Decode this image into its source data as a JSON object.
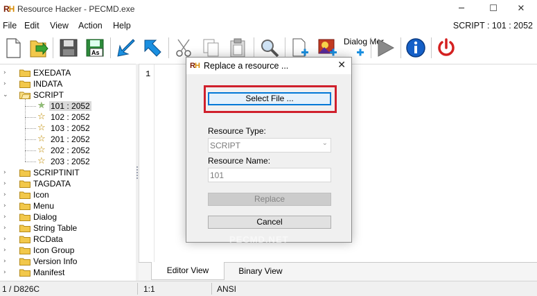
{
  "window": {
    "title": "Resource Hacker - PECMD.exe",
    "logo_text": "RH",
    "controls": [
      "─",
      "☐",
      "✕"
    ]
  },
  "menubar": {
    "items": [
      "File",
      "Edit",
      "View",
      "Action",
      "Help"
    ],
    "resource_id": "SCRIPT : 101 : 2052"
  },
  "toolbar": {
    "buttons": [
      "new-file-icon",
      "open-file-icon",
      "save-icon",
      "save-as-icon",
      "compile-icon",
      "run-script-icon",
      "cut-icon",
      "copy-icon",
      "paste-icon",
      "find-icon",
      "add-resource-icon",
      "replace-image-icon",
      "dialog-menu-icon",
      "play-icon",
      "info-icon",
      "power-icon"
    ],
    "dialog_menu_label": "Dialog Mer"
  },
  "tree": {
    "expanded_group": "SCRIPT",
    "items": [
      {
        "label": "EXEDATA",
        "kind": "folder"
      },
      {
        "label": "INDATA",
        "kind": "folder"
      },
      {
        "label": "SCRIPT",
        "kind": "folder-open"
      },
      {
        "label": "101 : 2052",
        "kind": "leaf",
        "selected": true
      },
      {
        "label": "102 : 2052",
        "kind": "leaf"
      },
      {
        "label": "103 : 2052",
        "kind": "leaf"
      },
      {
        "label": "201 : 2052",
        "kind": "leaf"
      },
      {
        "label": "202 : 2052",
        "kind": "leaf"
      },
      {
        "label": "203 : 2052",
        "kind": "leaf"
      },
      {
        "label": "SCRIPTINIT",
        "kind": "folder"
      },
      {
        "label": "TAGDATA",
        "kind": "folder"
      },
      {
        "label": "Icon",
        "kind": "folder"
      },
      {
        "label": "Menu",
        "kind": "folder"
      },
      {
        "label": "Dialog",
        "kind": "folder"
      },
      {
        "label": "String Table",
        "kind": "folder"
      },
      {
        "label": "RCData",
        "kind": "folder"
      },
      {
        "label": "Icon Group",
        "kind": "folder"
      },
      {
        "label": "Version Info",
        "kind": "folder"
      },
      {
        "label": "Manifest",
        "kind": "folder"
      }
    ]
  },
  "editor": {
    "line_number": "1",
    "tabs": [
      "Editor View",
      "Binary View"
    ],
    "active_tab": "Editor View"
  },
  "status": {
    "offset": "1 / D826C",
    "cursor": "1:1",
    "encoding": "ANSI"
  },
  "dialog": {
    "title": "Replace a resource ...",
    "select_file_label": "Select File ...",
    "resource_type_label": "Resource Type:",
    "resource_type_value": "SCRIPT",
    "resource_name_label": "Resource Name:",
    "resource_name_value": "101",
    "replace_label": "Replace",
    "cancel_label": "Cancel",
    "watermark": "PECMD.NET"
  },
  "colors": {
    "highlight": "#d0202c",
    "focus": "#0078d7",
    "folder": "#f2c84b"
  }
}
